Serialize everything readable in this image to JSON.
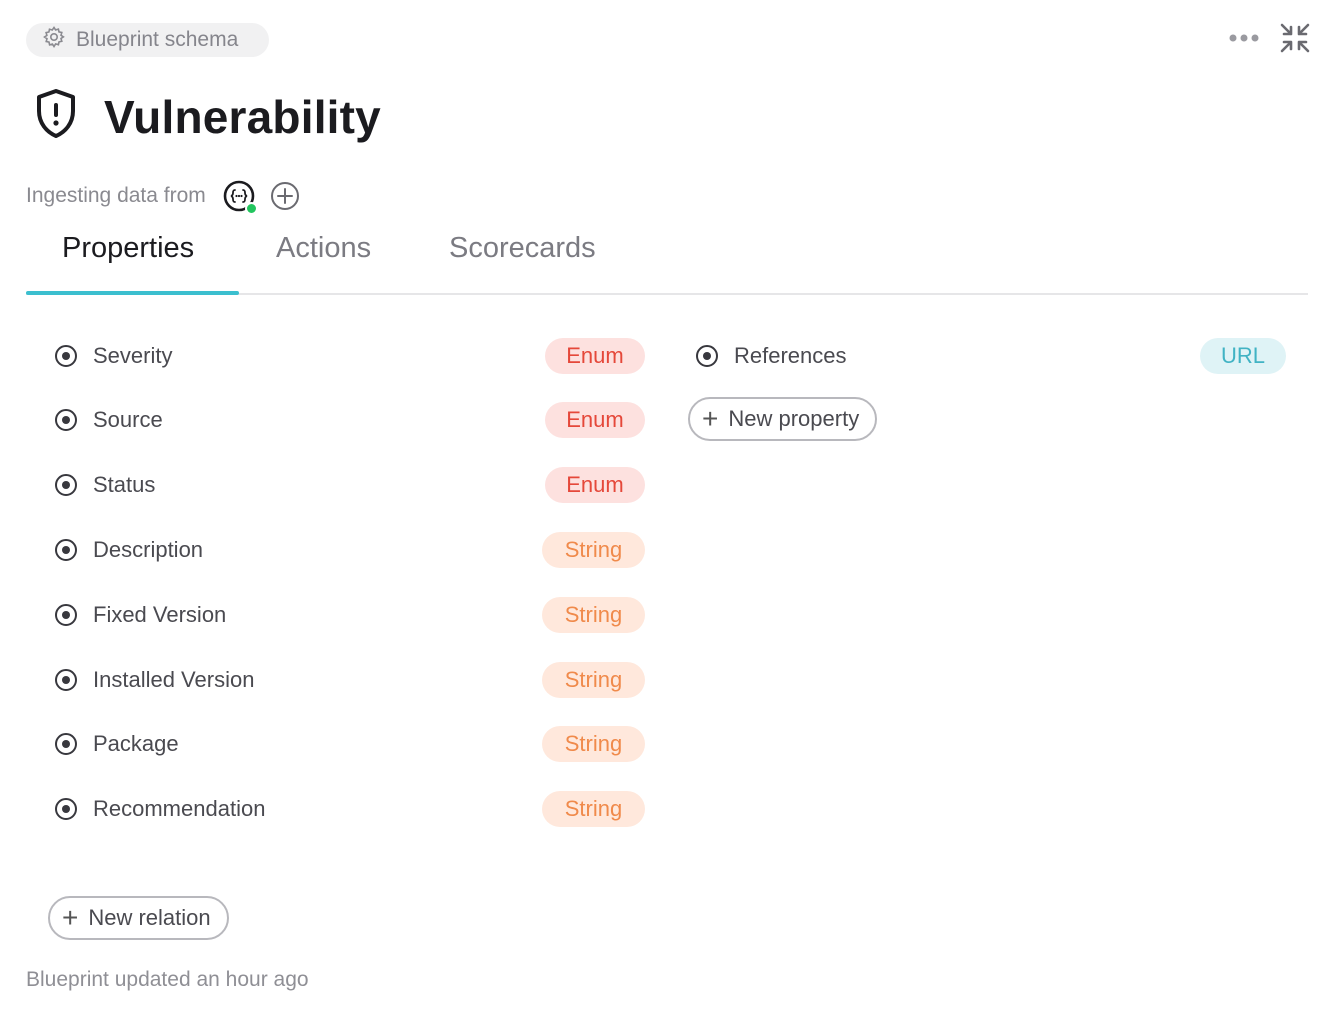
{
  "header": {
    "chip_label": "Blueprint schema",
    "chip_icon": "gear-icon",
    "title": "Vulnerability",
    "title_icon": "shield-alert-icon"
  },
  "ingest": {
    "label": "Ingesting data from",
    "source_icon": "api-braces-icon",
    "status_color": "#22c55e"
  },
  "tabs": [
    {
      "label": "Properties",
      "active": true
    },
    {
      "label": "Actions",
      "active": false
    },
    {
      "label": "Scorecards",
      "active": false
    }
  ],
  "properties_left": [
    {
      "name": "Severity",
      "type": "Enum"
    },
    {
      "name": "Source",
      "type": "Enum"
    },
    {
      "name": "Status",
      "type": "Enum"
    },
    {
      "name": "Description",
      "type": "String"
    },
    {
      "name": "Fixed Version",
      "type": "String"
    },
    {
      "name": "Installed Version",
      "type": "String"
    },
    {
      "name": "Package",
      "type": "String"
    },
    {
      "name": "Recommendation",
      "type": "String"
    }
  ],
  "properties_right": [
    {
      "name": "References",
      "type": "URL"
    }
  ],
  "buttons": {
    "new_property": "New property",
    "new_relation": "New relation"
  },
  "footer": {
    "updated_text": "Blueprint updated an hour ago"
  },
  "colors": {
    "accent": "#3bbfcf",
    "enum_bg": "#fde1df",
    "enum_text": "#e5483a",
    "string_bg": "#ffe8dc",
    "string_text": "#f08a4b",
    "url_bg": "#dff3f6",
    "url_text": "#41b3c4"
  }
}
